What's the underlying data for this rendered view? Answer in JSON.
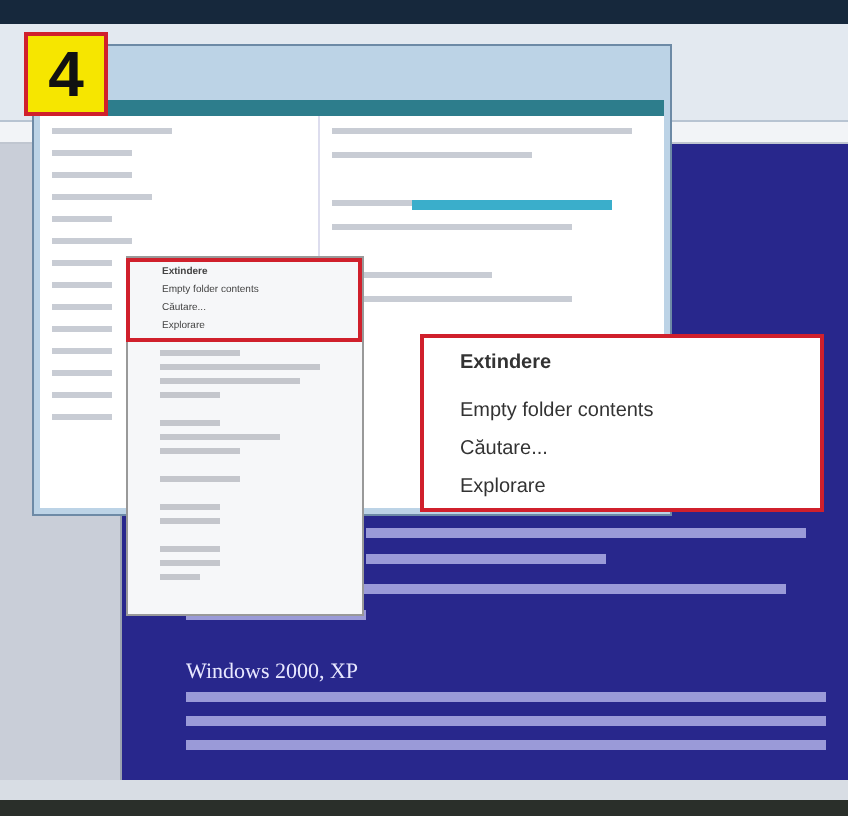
{
  "step_badge": "4",
  "context_menu": {
    "items": [
      {
        "label": "Extindere",
        "bold": true
      },
      {
        "label": "Empty folder contents",
        "bold": false
      },
      {
        "label": "Căutare...",
        "bold": false
      },
      {
        "label": "Explorare",
        "bold": false
      }
    ]
  },
  "callout": {
    "items": [
      {
        "label": "Extindere",
        "bold": true
      },
      {
        "label": "Empty folder contents",
        "bold": false
      },
      {
        "label": "Căutare...",
        "bold": false
      },
      {
        "label": "Explorare",
        "bold": false
      }
    ]
  },
  "document": {
    "heading": "Windows 2000, XP"
  }
}
